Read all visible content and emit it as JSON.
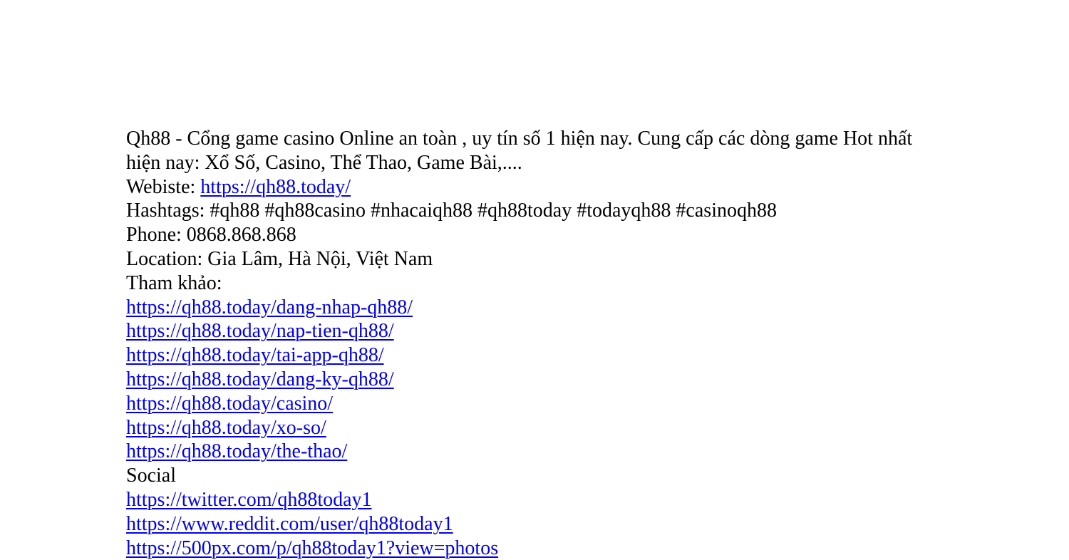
{
  "intro": "Qh88 - Cổng game casino Online an toàn , uy tín số 1 hiện nay. Cung cấp các dòng game Hot nhất hiện nay: Xổ Số, Casino, Thể Thao, Game Bài,....",
  "website": {
    "label": "Webiste: ",
    "link": "https://qh88.today/"
  },
  "hashtags": "Hashtags: #qh88 #qh88casino #nhacaiqh88 #qh88today #todayqh88 #casinoqh88",
  "phone": "Phone: 0868.868.868",
  "location": "Location: Gia Lâm, Hà Nội, Việt Nam",
  "reference": {
    "heading": "Tham khảo:",
    "links": [
      "https://qh88.today/dang-nhap-qh88/",
      "https://qh88.today/nap-tien-qh88/",
      "https://qh88.today/tai-app-qh88/",
      "https://qh88.today/dang-ky-qh88/",
      "https://qh88.today/casino/",
      "https://qh88.today/xo-so/",
      "https://qh88.today/the-thao/"
    ]
  },
  "social": {
    "heading": "Social",
    "links": [
      "https://twitter.com/qh88today1",
      "https://www.reddit.com/user/qh88today1",
      "https://500px.com/p/qh88today1?view=photos"
    ]
  },
  "colors": {
    "text": "#000000",
    "link": "#0000ee",
    "background": "#ffffff"
  }
}
